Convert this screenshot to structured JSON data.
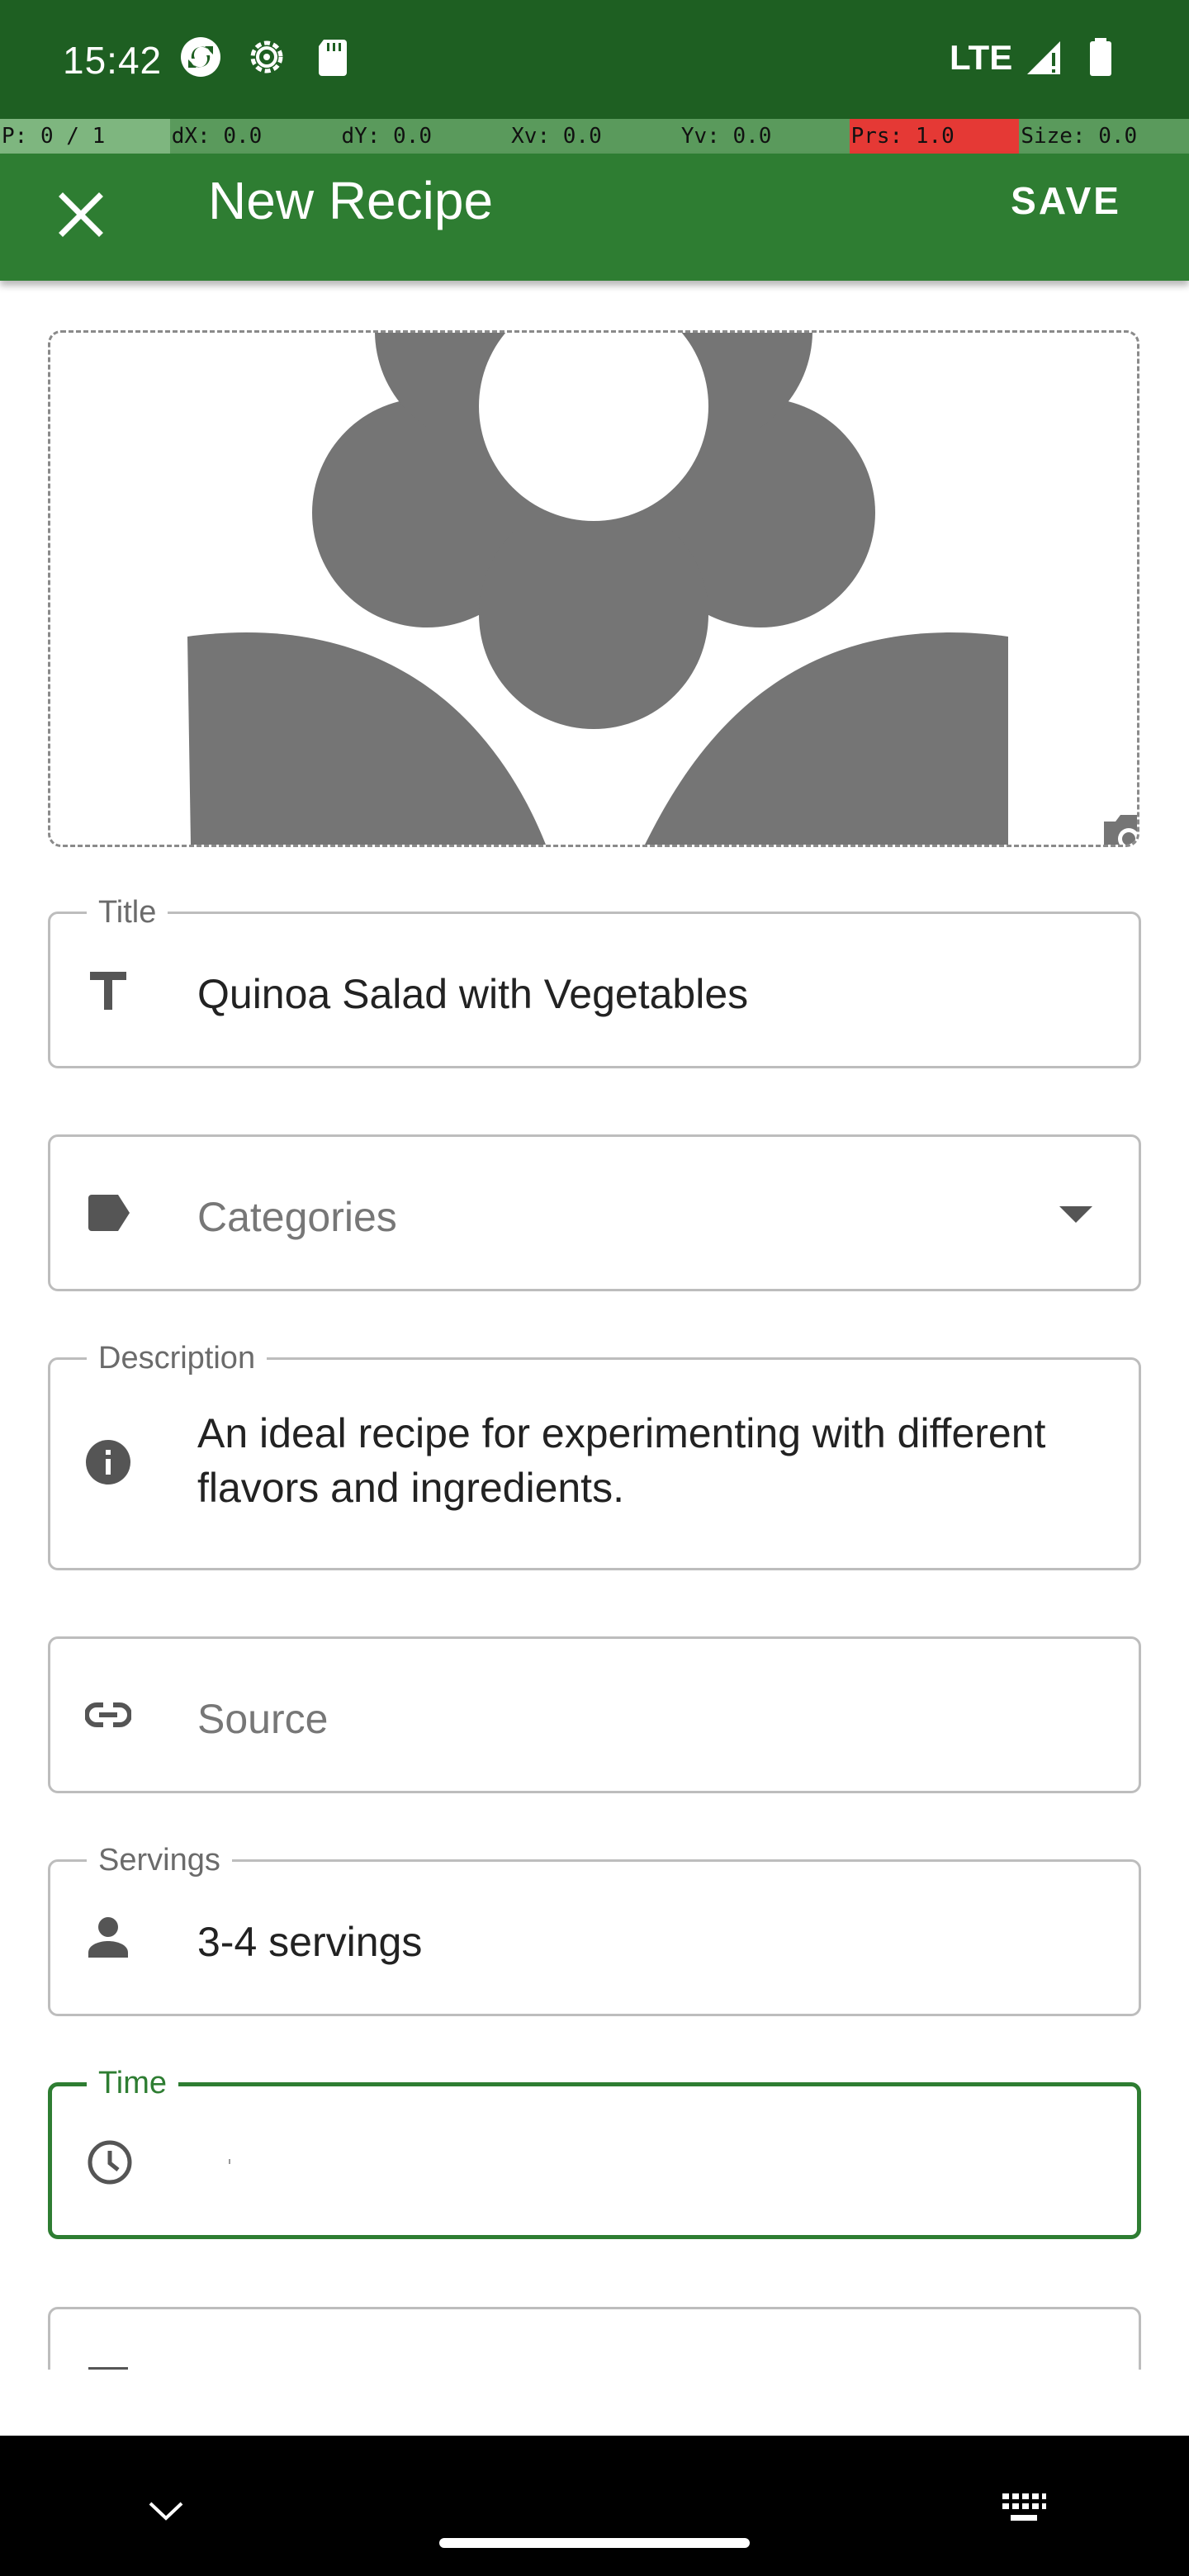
{
  "status_bar": {
    "time": "15:42",
    "network": "LTE"
  },
  "debug_bar": [
    "P: 0 / 1",
    "dX: 0.0",
    "dY: 0.0",
    "Xv: 0.0",
    "Yv: 0.0",
    "Prs: 1.0",
    "Size: 0.0"
  ],
  "app_bar": {
    "title": "New Recipe",
    "save_label": "SAVE"
  },
  "fields": {
    "title": {
      "label": "Title",
      "value": "Quinoa Salad with Vegetables",
      "icon": "title-t-icon"
    },
    "categories": {
      "placeholder": "Categories",
      "icon": "label-tag-icon"
    },
    "description": {
      "label": "Description",
      "value": "An ideal recipe for experimenting with different flavors and ingredients.",
      "icon": "info-icon"
    },
    "source": {
      "placeholder": "Source",
      "icon": "link-icon"
    },
    "servings": {
      "label": "Servings",
      "value": "3-4 servings",
      "icon": "person-icon"
    },
    "time": {
      "label": "Time",
      "value": "",
      "icon": "clock-icon"
    }
  },
  "colors": {
    "primary": "#2e7d32",
    "status_bar": "#1e5f22",
    "placeholder_image": "#757575"
  }
}
